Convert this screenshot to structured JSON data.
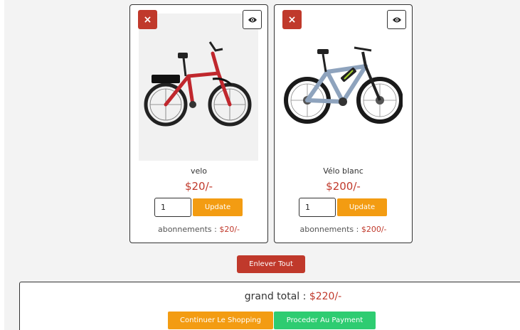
{
  "cart": {
    "items": [
      {
        "name": "velo",
        "price": "$20/-",
        "quantity": "1",
        "update_label": "Update",
        "subtotal_label": "abonnements :",
        "subtotal": "$20/-",
        "remove_icon": "×",
        "view_icon": "eye-icon",
        "bike_color": "#c0272d"
      },
      {
        "name": "Vélo blanc",
        "price": "$200/-",
        "quantity": "1",
        "update_label": "Update",
        "subtotal_label": "abonnements :",
        "subtotal": "$200/-",
        "remove_icon": "×",
        "view_icon": "eye-icon",
        "bike_color": "#8ea3bd"
      }
    ],
    "clear_label": "Enlever Tout"
  },
  "summary": {
    "total_label": "grand total :",
    "total_value": "$220/-",
    "continue_label": "Continuer Le Shopping",
    "payment_label": "Proceder Au Payment"
  },
  "colors": {
    "danger": "#c0392b",
    "warning": "#f39c12",
    "success": "#2ecc71",
    "background": "#f3f3f3"
  }
}
